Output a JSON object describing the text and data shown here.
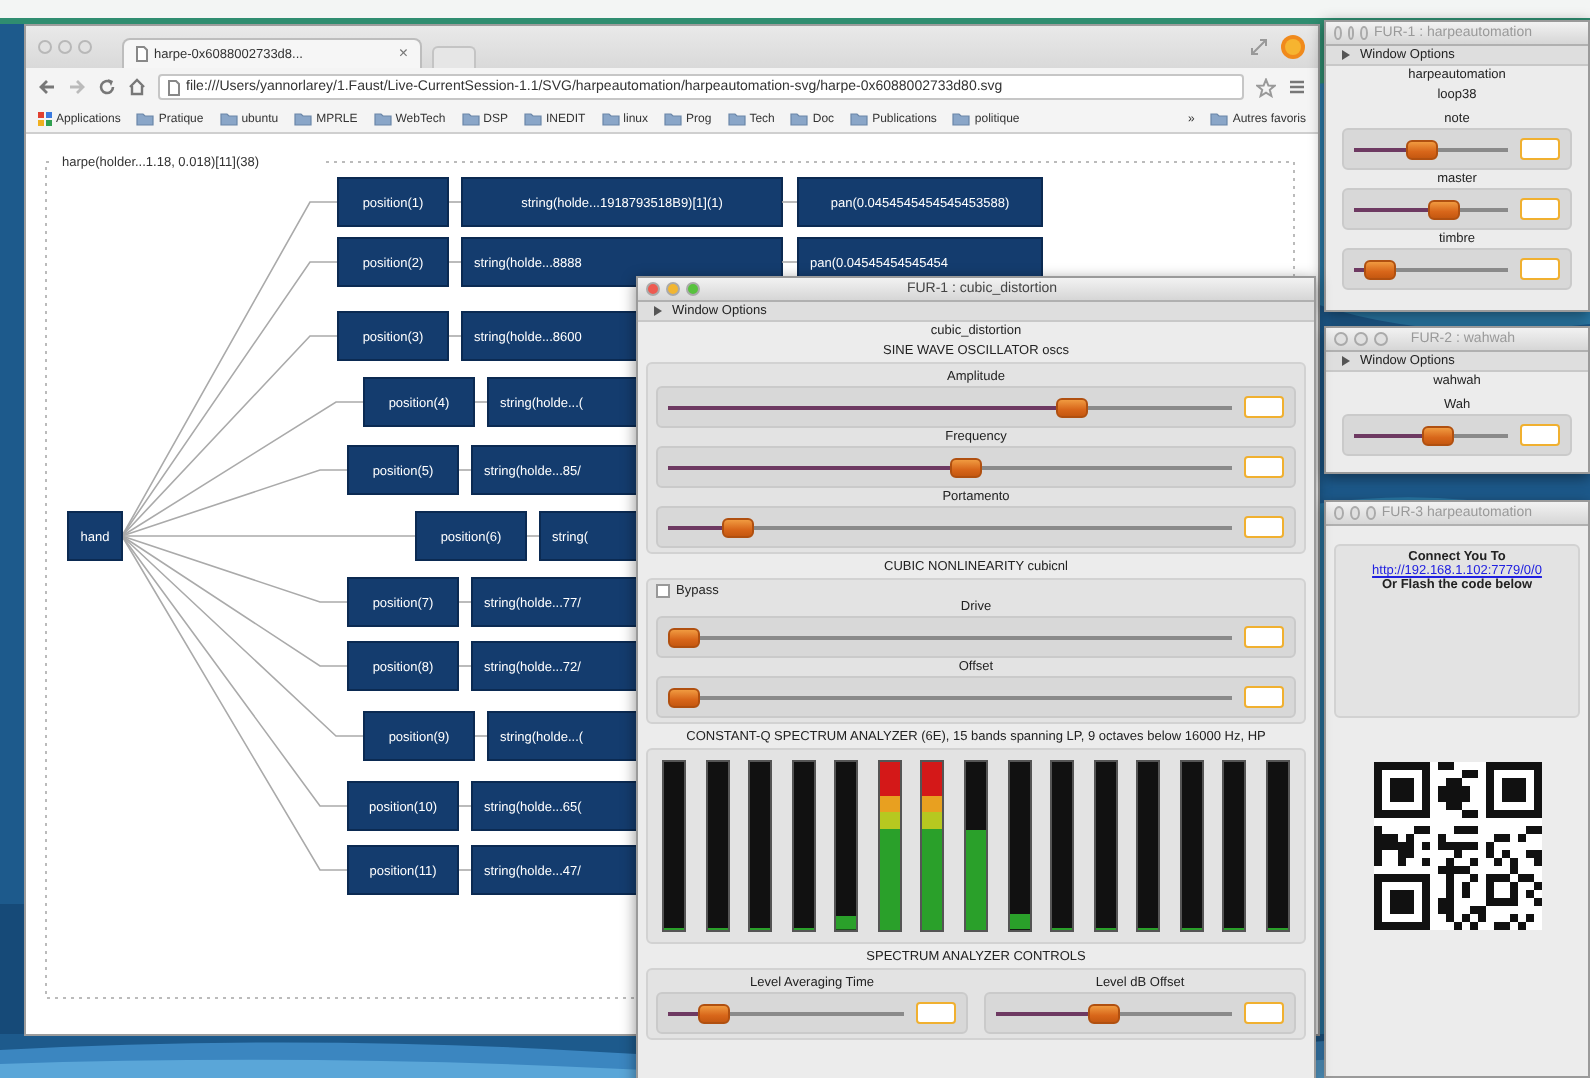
{
  "browser": {
    "tab_title": "harpe-0x6088002733d8...",
    "tab_close": "×",
    "url": "file:///Users/yannorlarey/1.Faust/Live-CurrentSession-1.1/SVG/harpeautomation/harpeautomation-svg/harpe-0x6088002733d80.svg",
    "bookmarks": [
      {
        "kind": "apps",
        "label": "Applications"
      },
      {
        "kind": "folder",
        "label": "Pratique"
      },
      {
        "kind": "folder",
        "label": "ubuntu"
      },
      {
        "kind": "folder",
        "label": "MPRLE"
      },
      {
        "kind": "folder",
        "label": "WebTech"
      },
      {
        "kind": "folder",
        "label": "DSP"
      },
      {
        "kind": "folder",
        "label": "INEDIT"
      },
      {
        "kind": "folder",
        "label": "linux"
      },
      {
        "kind": "folder",
        "label": "Prog"
      },
      {
        "kind": "folder",
        "label": "Tech"
      },
      {
        "kind": "folder",
        "label": "Doc"
      },
      {
        "kind": "folder",
        "label": "Publications"
      },
      {
        "kind": "folder",
        "label": "politique"
      }
    ],
    "more": "»",
    "other_bookmarks": "Autres favoris"
  },
  "diagram": {
    "title": "harpe(holder...1.18, 0.018)[11](38)",
    "root": "hand",
    "rows": [
      {
        "position": "position(1)",
        "string": "string(holde...1918793518B9)[1](1)",
        "pan": "pan(0.0454545454545453588)"
      },
      {
        "position": "position(2)",
        "string": "string(holde...8888",
        "pan": "pan(0.04545454545454"
      },
      {
        "position": "position(3)",
        "string": "string(holde...8600"
      },
      {
        "position": "position(4)",
        "string": "string(holde...("
      },
      {
        "position": "position(5)",
        "string": "string(holde...85/"
      },
      {
        "position": "position(6)",
        "string": "string("
      },
      {
        "position": "position(7)",
        "string": "string(holde...77/"
      },
      {
        "position": "position(8)",
        "string": "string(holde...72/"
      },
      {
        "position": "position(9)",
        "string": "string(holde...("
      },
      {
        "position": "position(10)",
        "string": "string(holde...65("
      },
      {
        "position": "position(11)",
        "string": "string(holde...47/"
      }
    ]
  },
  "windows": [
    {
      "title": "FUR-1 : cubic_distortion",
      "active": true,
      "menu": "Window Options",
      "heading": "cubic_distortion",
      "sections": [
        {
          "title": "SINE WAVE OSCILLATOR oscs",
          "kind": "group",
          "items": [
            {
              "kind": "slider",
              "label": "Amplitude",
              "level": 0.73
            },
            {
              "kind": "slider",
              "label": "Frequency",
              "level": 0.53
            },
            {
              "kind": "slider",
              "label": "Portamento",
              "level": 0.1
            }
          ]
        },
        {
          "title": "CUBIC NONLINEARITY cubicnl",
          "kind": "group",
          "items": [
            {
              "kind": "checkbox",
              "label": "Bypass",
              "checked": false
            },
            {
              "kind": "slider",
              "label": "Drive",
              "level": 0
            },
            {
              "kind": "slider",
              "label": "Offset",
              "level": 0
            }
          ]
        },
        {
          "title": "CONSTANT-Q SPECTRUM ANALYZER (6E), 15 bands spanning LP, 9 octaves below 16000 Hz, HP",
          "kind": "group",
          "items": [
            {
              "kind": "meters",
              "meters": [
                {
                  "level": 0
                },
                {
                  "level": 0
                },
                {
                  "level": 0
                },
                {
                  "level": 0
                },
                {
                  "level": 0.08
                },
                {
                  "level": 1
                },
                {
                  "level": 1
                },
                {
                  "level": 0.6
                },
                {
                  "level": 0.09
                },
                {
                  "level": 0
                },
                {
                  "level": 0
                },
                {
                  "level": 0
                },
                {
                  "level": 0
                },
                {
                  "level": 0
                },
                {
                  "level": 0
                }
              ]
            }
          ]
        },
        {
          "title": "SPECTRUM ANALYZER CONTROLS",
          "kind": "row",
          "items": [
            {
              "kind": "slider",
              "label": "Level Averaging Time",
              "level": 0.15
            },
            {
              "kind": "slider",
              "label": "Level dB Offset",
              "level": 0.45
            }
          ]
        }
      ]
    },
    {
      "title": "FUR-1 : harpeautomation",
      "active": false,
      "menu": "Window Options",
      "heading": "harpeautomation",
      "sections": [
        {
          "title": "loop38",
          "kind": "plain",
          "items": [
            {
              "kind": "slider",
              "label": "note",
              "level": 0.42
            },
            {
              "kind": "slider",
              "label": "master",
              "level": 0.6
            },
            {
              "kind": "slider",
              "label": "timbre",
              "level": 0.08
            }
          ]
        }
      ]
    },
    {
      "title": "FUR-2 : wahwah",
      "active": false,
      "menu": "Window Options",
      "heading": "wahwah",
      "sections": [
        {
          "kind": "plain",
          "items": [
            {
              "kind": "slider",
              "label": "Wah",
              "level": 0.55
            }
          ]
        }
      ]
    },
    {
      "title": "FUR-3 harpeautomation",
      "active": false,
      "sections": [
        {
          "kind": "group",
          "items": [
            {
              "kind": "text",
              "label": "Connect You To"
            },
            {
              "kind": "link",
              "label": "http://192.168.1.102:7779/0/0"
            },
            {
              "kind": "text",
              "label": "Or Flash the code below"
            }
          ]
        },
        {
          "kind": "plain",
          "items": [
            {
              "kind": "qr"
            }
          ]
        }
      ]
    }
  ]
}
